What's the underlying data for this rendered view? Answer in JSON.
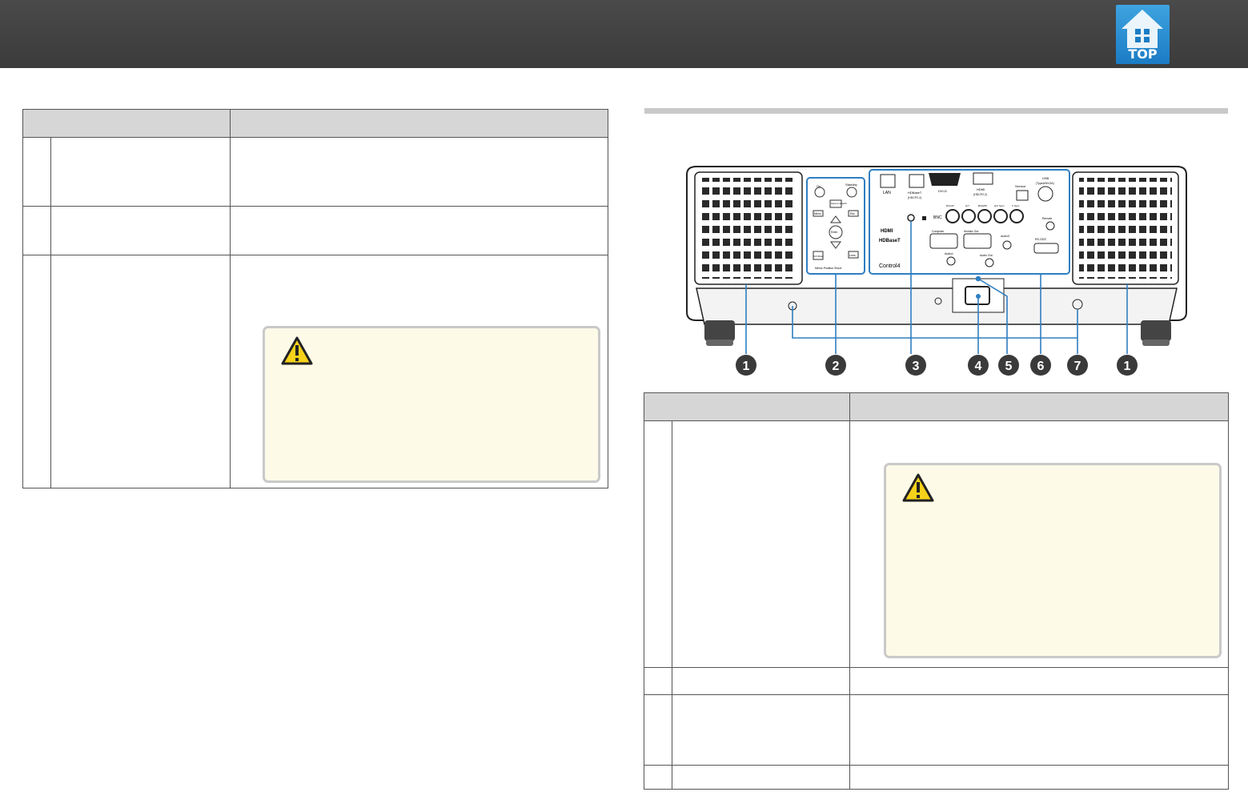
{
  "header": {
    "top_button_label": "TOP",
    "icon": "home-icon"
  },
  "figure": {
    "callouts": [
      "1",
      "2",
      "3",
      "4",
      "5",
      "6",
      "7",
      "1"
    ],
    "ports": {
      "lan": "LAN",
      "hdbaset": "HDBaseT",
      "hdcp": "(HDCP2.2)",
      "dvi": "DVI-D",
      "hdmi": "HDMI",
      "hdmi_hdcp": "(HDCP2.2)",
      "service": "Service",
      "usb": "USB",
      "usb_sub": "(TypeA/5V/2A)",
      "bnc": "BNC",
      "bnc_labels": [
        "R/Cr/Pr",
        "G/Y",
        "B/Cb/Pb",
        "H/C Sync",
        "V Sync"
      ],
      "remote": "Remote",
      "audio3": "Audio3",
      "rs232c": "RS-232C",
      "computer": "Computer",
      "monitor_out": "Monitor Out",
      "audio1": "Audio1",
      "audio_out": "Audio Out",
      "hdmi_logo": "HDMI",
      "hdbaset_logo": "HDBaseT",
      "control4": "Control4"
    },
    "panel_buttons": {
      "on": "On",
      "standby": "Standby",
      "source_search": "Source Search",
      "menu": "Menu",
      "esc": "Esc",
      "enter": "Enter",
      "av_mute": "A/V Mute",
      "lens": "Lens",
      "memo": "Memo Position Shoot"
    }
  },
  "colors": {
    "header_bg": "#3b3b3b",
    "top_button": "#1b7cc4",
    "callout": "#3a3a3a",
    "highlight": "#2f7fc1",
    "caution_bg": "#fdfae8",
    "table_head": "#d6d6d6"
  },
  "icons": {
    "caution": "warning-triangle-icon"
  }
}
